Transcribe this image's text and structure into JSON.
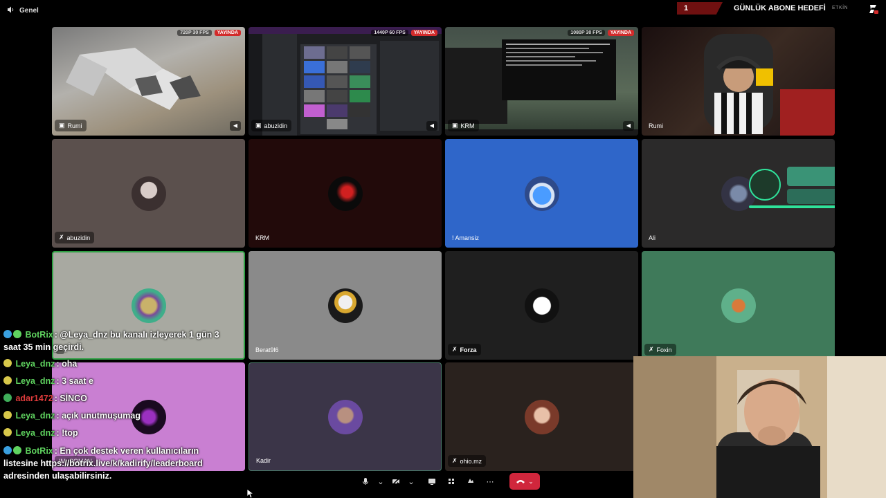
{
  "topbar": {
    "channel": "Genel",
    "goal_count": "1",
    "goal_title": "GÜNLÜK ABONE HEDEFİ",
    "goal_status": "ETKİN"
  },
  "tiles": {
    "t1": {
      "name": "Rumi",
      "quality": "720P 30 FPS",
      "live": "YAYINDA"
    },
    "t2": {
      "name": "abuzidin",
      "quality": "1440P 60 FPS",
      "live": "YAYINDA"
    },
    "t3": {
      "name": "KRM",
      "quality": "1080P 30 FPS",
      "live": "YAYINDA"
    },
    "t4": {
      "name": "Rumi"
    },
    "t5": {
      "name": "abuzidin"
    },
    "t6": {
      "name": "KRM"
    },
    "t7": {
      "name": "! Amansiz"
    },
    "t8": {
      "name": "Ali"
    },
    "t9": {
      "name": ""
    },
    "t10": {
      "name": "Berat9l6"
    },
    "t11": {
      "name": "Forza"
    },
    "t12": {
      "name": "Foxin"
    },
    "t13": {
      "name": "IM_POMAN"
    },
    "t14": {
      "name": "Kadir"
    },
    "t15": {
      "name": "ohio.mz"
    }
  },
  "chat": [
    {
      "user": "BotRix",
      "user_color": "#5fd35f",
      "text": "@Leya_dnz bu kanalı izleyerek 1 gün 3 saat 35 min geçirdi."
    },
    {
      "user": "Leya_dnz",
      "user_color": "#5fd35f",
      "text": "oha"
    },
    {
      "user": "Leya_dnz",
      "user_color": "#5fd35f",
      "text": "3 saat e"
    },
    {
      "user": "adar1472",
      "user_color": "#e03c3c",
      "text": "SİNCO"
    },
    {
      "user": "Leya_dnz",
      "user_color": "#5fd35f",
      "text": "açık unutmuşumag"
    },
    {
      "user": "Leya_dnz",
      "user_color": "#5fd35f",
      "text": "!top"
    },
    {
      "user": "BotRix",
      "user_color": "#5fd35f",
      "text": "En çok destek veren kullanıcıların listesine https://botrix.live/k/kadirify/leaderboard adresinden ulaşabilirsiniz."
    }
  ],
  "icons": {
    "speaker": "speaker-icon",
    "mic": "microphone-icon",
    "camera": "camera-off-icon",
    "screen": "screen-share-icon",
    "activities": "activities-icon",
    "soundboard": "soundboard-icon",
    "more": "more-icon",
    "hangup": "hangup-icon"
  },
  "colors": {
    "hangup": "#d0263c",
    "live": "#d22b2b",
    "speaking_border": "#2ea043",
    "amansiz_bg": "#2f66c9",
    "foxin_bg": "#3f7a5a",
    "poman_bg": "#c97fd2"
  }
}
